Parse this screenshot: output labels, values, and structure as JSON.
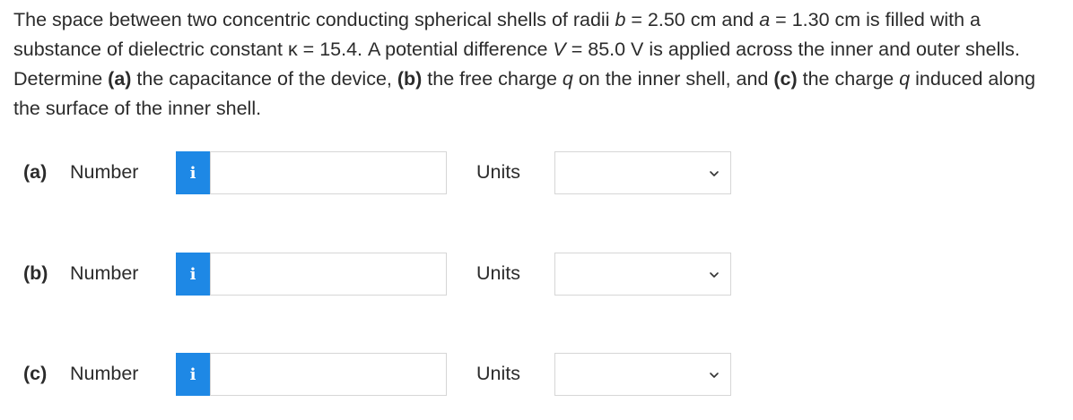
{
  "question": {
    "p1": "The space between two concentric conducting spherical shells of radii ",
    "var_b": "b",
    "p2": " = 2.50 cm and ",
    "var_a": "a",
    "p3": " = 1.30 cm is filled with a substance of dielectric constant κ = 15.4. A potential difference ",
    "var_V": "V",
    "p4": " = 85.0 V is applied across the inner and outer shells. Determine ",
    "label_a": "(a)",
    "p5": " the capacitance of the device, ",
    "label_b": "(b)",
    "p6": " the free charge ",
    "var_q1": "q",
    "p7": " on the inner shell, and ",
    "label_c": "(c)",
    "p8": " the charge ",
    "var_q2": "q",
    "p9": " induced along the surface of the inner shell."
  },
  "parts": [
    {
      "label": "(a)",
      "number_label": "Number",
      "info_icon": "i",
      "value": "",
      "units_label": "Units",
      "units_value": ""
    },
    {
      "label": "(b)",
      "number_label": "Number",
      "info_icon": "i",
      "value": "",
      "units_label": "Units",
      "units_value": ""
    },
    {
      "label": "(c)",
      "number_label": "Number",
      "info_icon": "i",
      "value": "",
      "units_label": "Units",
      "units_value": ""
    }
  ],
  "icons": {
    "info": "info-icon",
    "dropdown": "chevron-down-icon"
  },
  "colors": {
    "info_button": "#1e88e5",
    "text": "#2b2b2b",
    "input_border": "#d6d6d6"
  }
}
